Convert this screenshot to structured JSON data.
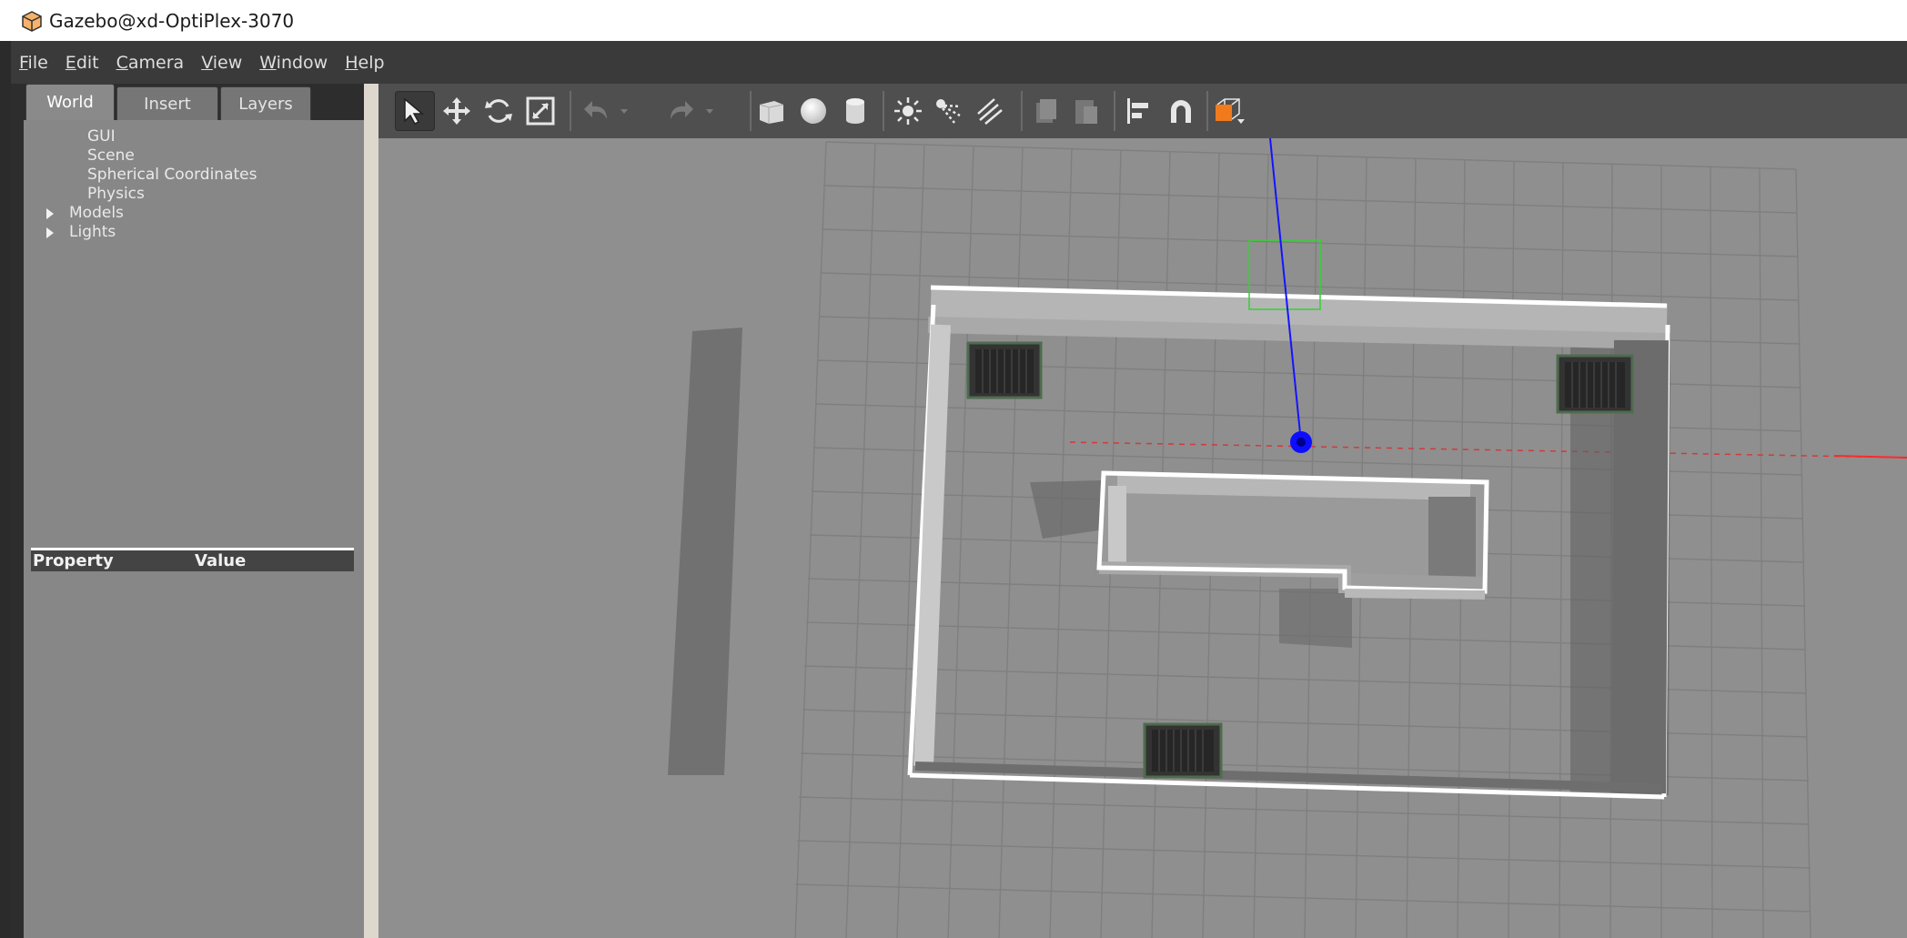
{
  "window": {
    "title": "Gazebo@xd-OptiPlex-3070"
  },
  "menu": [
    "File",
    "Edit",
    "Camera",
    "View",
    "Window",
    "Help"
  ],
  "left_panel": {
    "tabs": [
      "World",
      "Insert",
      "Layers"
    ],
    "active_tab": "World",
    "tree": [
      {
        "label": "GUI",
        "expandable": false
      },
      {
        "label": "Scene",
        "expandable": false
      },
      {
        "label": "Spherical Coordinates",
        "expandable": false
      },
      {
        "label": "Physics",
        "expandable": false
      },
      {
        "label": "Models",
        "expandable": true
      },
      {
        "label": "Lights",
        "expandable": true
      }
    ],
    "property_table": {
      "col1": "Property",
      "col2": "Value"
    }
  },
  "toolbar": {
    "tools": [
      "select-mode-icon",
      "translate-mode-icon",
      "rotate-mode-icon",
      "scale-mode-icon",
      "undo-icon",
      "undo-dropdown-icon",
      "redo-icon",
      "redo-dropdown-icon",
      "box-shape-icon",
      "sphere-shape-icon",
      "cylinder-shape-icon",
      "point-light-icon",
      "spot-light-icon",
      "directional-light-icon",
      "copy-icon",
      "paste-icon",
      "align-icon",
      "snap-icon",
      "view-angle-icon"
    ],
    "active_tool": "select-mode-icon",
    "accent_color": "#f07a1c"
  },
  "scene": {
    "background": "#8f8f8f",
    "grid_color": "#7d7d7d",
    "wall_color": "#ffffff",
    "axis_z_color": "#0000ff",
    "axis_x_color": "#ff0000",
    "bounding_box_color": "#2fd42f"
  }
}
